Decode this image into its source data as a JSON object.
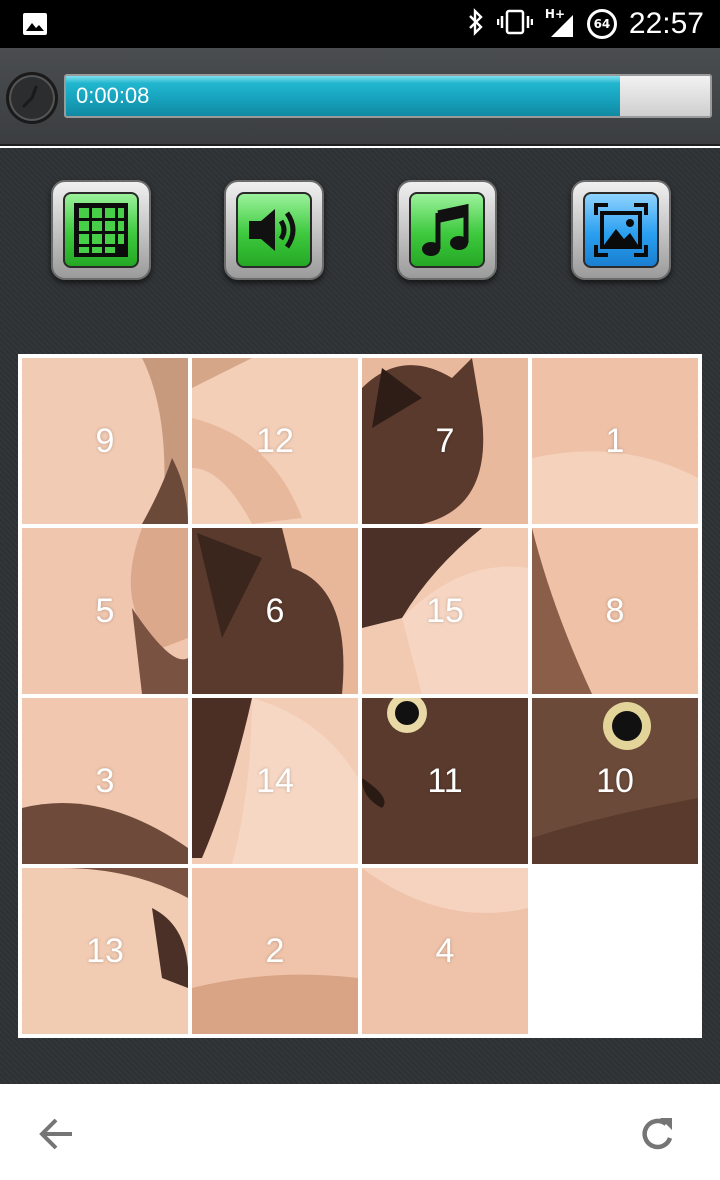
{
  "status_bar": {
    "time": "22:57",
    "battery": "64",
    "network": "H+",
    "icons": [
      "image-icon",
      "bluetooth-icon",
      "vibrate-icon",
      "signal-icon",
      "battery-icon"
    ]
  },
  "timer": {
    "elapsed": "0:00:08",
    "progress": 0.86,
    "icon": "clock-icon"
  },
  "toolbar": {
    "buttons": [
      {
        "name": "grid-size",
        "icon": "grid-icon",
        "style": "green"
      },
      {
        "name": "sound",
        "icon": "speaker-icon",
        "style": "green"
      },
      {
        "name": "music",
        "icon": "music-note-icon",
        "style": "green"
      },
      {
        "name": "change-image",
        "icon": "image-frame-icon",
        "style": "blue"
      }
    ]
  },
  "board": {
    "rows": 4,
    "cols": 4,
    "tiles": [
      "9",
      "12",
      "7",
      "1",
      "5",
      "6",
      "15",
      "8",
      "3",
      "14",
      "11",
      "10",
      "13",
      "2",
      "4",
      ""
    ],
    "empty_index": 15
  },
  "nav": {
    "back_icon": "back-arrow-icon",
    "refresh_icon": "refresh-icon"
  },
  "colors": {
    "progress": "#16a1bb",
    "toolbar_green": "#3ec93e",
    "toolbar_blue": "#2a9ff0",
    "skin": "#f0c6ae",
    "cat_fur": "#5a3a2c"
  }
}
